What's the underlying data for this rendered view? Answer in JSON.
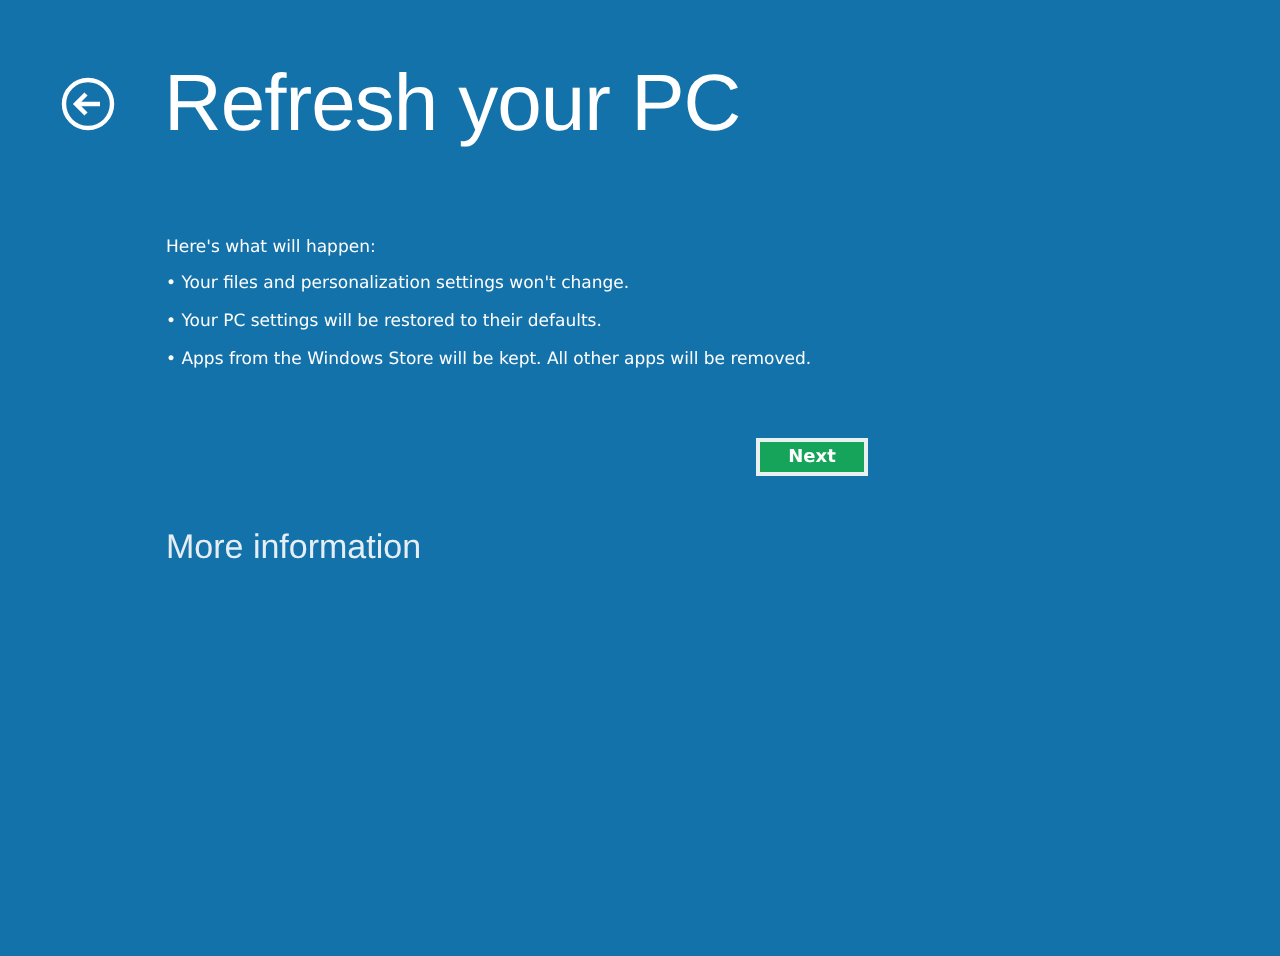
{
  "title": "Refresh your PC",
  "intro": "Here's what will happen:",
  "bullets": [
    "• Your files and personalization settings won't change.",
    "• Your PC settings will be restored to their defaults.",
    "• Apps from the Windows Store will be kept. All other apps will be removed."
  ],
  "next_button": "Next",
  "more_link": "More information"
}
